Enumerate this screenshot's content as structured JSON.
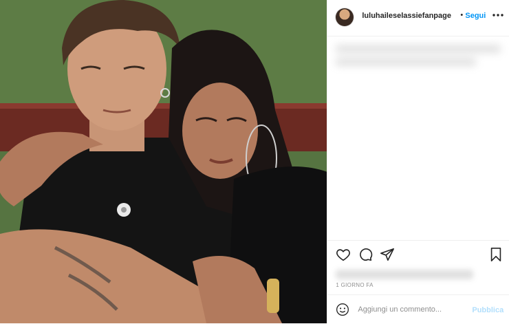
{
  "post": {
    "username": "luluhaileselassiefanpage",
    "separator": "•",
    "follow_label": "Segui",
    "timestamp": "1 GIORNO FA"
  },
  "comment": {
    "placeholder": "Aggiungi un commento...",
    "publish_label": "Pubblica"
  },
  "icons": {
    "more": "more-options-icon",
    "like": "heart-icon",
    "comment": "comment-bubble-icon",
    "share": "paper-plane-icon",
    "save": "bookmark-icon",
    "emoji": "emoji-icon"
  },
  "colors": {
    "accent": "#0095f6",
    "publish_disabled": "#b2dffc",
    "muted_text": "#8e8e8e",
    "border": "#efefef"
  }
}
